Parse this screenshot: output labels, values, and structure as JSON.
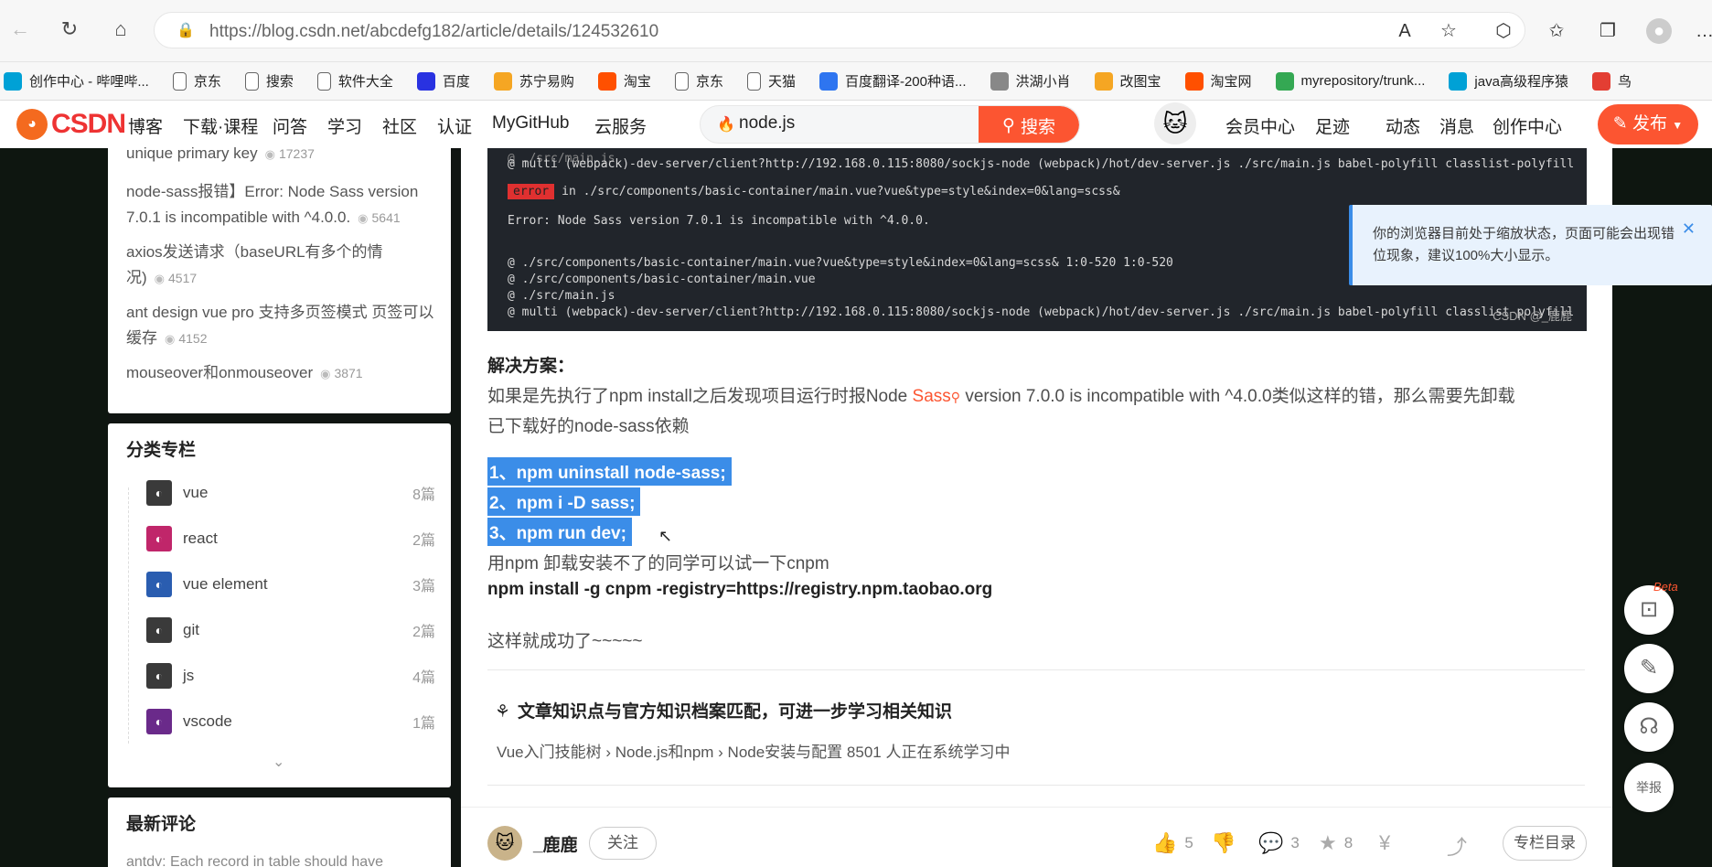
{
  "browser": {
    "url": "https://blog.csdn.net/abcdefg182/article/details/124532610",
    "bookmarks": [
      {
        "label": "创作中心 - 哔哩哔...",
        "icon": "bilibili-icon",
        "color": "#00a1d6"
      },
      {
        "label": "京东",
        "icon": "page-icon",
        "color": "#666666"
      },
      {
        "label": "搜索",
        "icon": "page-icon",
        "color": "#666666"
      },
      {
        "label": "软件大全",
        "icon": "page-icon",
        "color": "#666666"
      },
      {
        "label": "百度",
        "icon": "baidu-icon",
        "color": "#2932e1"
      },
      {
        "label": "苏宁易购",
        "icon": "suning-icon",
        "color": "#f5a623"
      },
      {
        "label": "淘宝",
        "icon": "taobao-icon",
        "color": "#ff5000"
      },
      {
        "label": "京东",
        "icon": "page-icon",
        "color": "#666666"
      },
      {
        "label": "天猫",
        "icon": "page-icon",
        "color": "#666666"
      },
      {
        "label": "百度翻译-200种语...",
        "icon": "fanyi-icon",
        "color": "#2e75f0"
      },
      {
        "label": "洪湖小肖",
        "icon": "bird-icon",
        "color": "#888888"
      },
      {
        "label": "改图宝",
        "icon": "gaitubao-icon",
        "color": "#f5a623"
      },
      {
        "label": "淘宝网",
        "icon": "taobao-icon",
        "color": "#ff5000"
      },
      {
        "label": "myrepository/trunk...",
        "icon": "chrome-icon",
        "color": "#34a853"
      },
      {
        "label": "java高级程序猿",
        "icon": "bilibili-icon",
        "color": "#00a1d6"
      },
      {
        "label": "鸟",
        "icon": "bird-icon",
        "color": "#e33e33"
      }
    ]
  },
  "header": {
    "logo": "CSDN",
    "nav": [
      "博客",
      "下载·课程",
      "问答",
      "学习",
      "社区",
      "认证",
      "MyGitHub",
      "云服务"
    ],
    "search_value": "node.js",
    "search_button": "搜索",
    "right": [
      "会员中心",
      "足迹",
      "动态",
      "消息",
      "创作中心"
    ],
    "publish": "发布",
    "accent": "#fc5531"
  },
  "sidebar": {
    "hot": [
      {
        "title": "unique primary key",
        "views": "17237"
      },
      {
        "title": "node-sass报错】Error: Node Sass version 7.0.1 is incompatible with ^4.0.0.",
        "views": "5641"
      },
      {
        "title": "axios发送请求（baseURL有多个的情况)",
        "views": "4517"
      },
      {
        "title": "ant design vue pro 支持多页签模式 页签可以缓存",
        "views": "4152"
      },
      {
        "title": "mouseover和onmouseover",
        "views": "3871"
      }
    ],
    "columns_title": "分类专栏",
    "columns": [
      {
        "name": "vue",
        "count": "8篇"
      },
      {
        "name": "react",
        "count": "2篇"
      },
      {
        "name": "vue element",
        "count": "3篇"
      },
      {
        "name": "git",
        "count": "2篇"
      },
      {
        "name": "js",
        "count": "4篇"
      },
      {
        "name": "vscode",
        "count": "1篇"
      }
    ],
    "comments_title": "最新评论",
    "comment_preview": "antdv: Each record in table should have"
  },
  "code": {
    "lines": [
      "@ multi (webpack)-dev-server/client?http://192.168.0.115:8080/sockjs-node (webpack)/hot/dev-server.js ./src/main.js babel-polyfill classlist-polyfill",
      "in ./src/components/basic-container/main.vue?vue&type=style&index=0&lang=scss&",
      "Error: Node Sass version 7.0.1 is incompatible with ^4.0.0.",
      "@ ./src/components/basic-container/main.vue?vue&type=style&index=0&lang=scss& 1:0-520 1:0-520",
      "@ ./src/components/basic-container/main.vue",
      "@ ./src/main.js",
      "@ multi (webpack)-dev-server/client?http://192.168.0.115:8080/sockjs-node (webpack)/hot/dev-server.js ./src/main.js babel-polyfill classlist-polyfill"
    ],
    "error_tag": "error",
    "watermark": "CSDN @_鹿鹿"
  },
  "article": {
    "solution_heading": "解决方案：",
    "para1_a": "如果是先执行了npm install之后发现项目运行时报Node",
    "para1_link": "Sass",
    "para1_b": "version 7.0.0 is incompatible with ^4.0.0类似这样的错，那么需要先卸载",
    "para1_c": "已下载好的node-sass依赖",
    "steps": [
      "1、npm uninstall node-sass;",
      "2、npm i -D sass;",
      "3、npm run dev;"
    ],
    "cnpm_note": "用npm 卸载安装不了的同学可以试一下cnpm",
    "cnpm_cmd": "npm install -g cnpm -registry=https://registry.npm.taobao.org",
    "success": "这样就成功了~~~~~",
    "knowledge_title": "文章知识点与官方知识档案匹配，可进一步学习相关知识",
    "knowledge_path": "Vue入门技能树 › Node.js和npm › Node安装与配置    8501 人正在系统学习中"
  },
  "toast": {
    "text": "你的浏览器目前处于缩放状态，页面可能会出现错位现象，建议100%大小显示。"
  },
  "bottom": {
    "author": "_鹿鹿",
    "follow": "关注",
    "likes": "5",
    "comments": "3",
    "favorites": "8",
    "toc": "专栏目录"
  },
  "float": {
    "beta": "Beta",
    "report": "举报"
  }
}
